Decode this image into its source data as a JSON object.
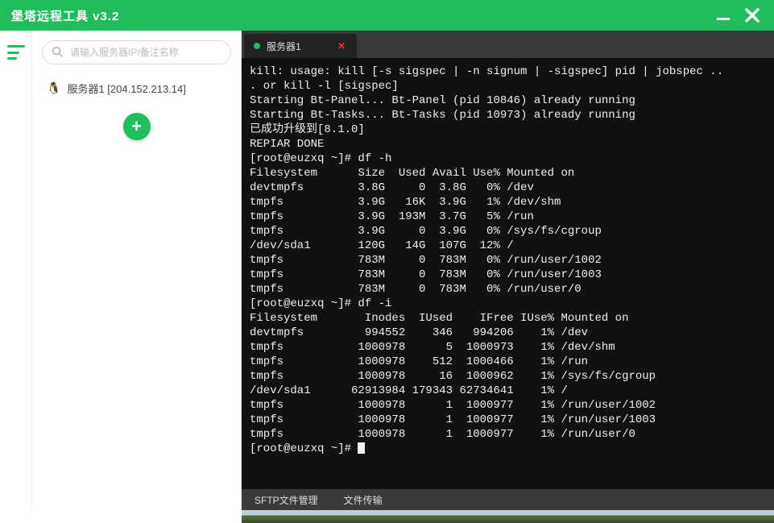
{
  "colors": {
    "accent": "#1fbe5b"
  },
  "titlebar": {
    "title": "堡塔远程工具 v3.2"
  },
  "sidebar": {
    "search_placeholder": "请输入服务器IP/备注名称",
    "servers": [
      {
        "icon": "penguin",
        "label": "服务器1 [204.152.213.14]"
      }
    ],
    "add_label": "+"
  },
  "tabs": [
    {
      "label": "服务器1",
      "active": true,
      "status": "connected"
    }
  ],
  "terminal": {
    "prompt": "[root@euzxq ~]#",
    "lines": [
      "kill: usage: kill [-s sigspec | -n signum | -sigspec] pid | jobspec ..",
      ". or kill -l [sigspec]",
      "Starting Bt-Panel... Bt-Panel (pid 10846) already running",
      "Starting Bt-Tasks... Bt-Tasks (pid 10973) already running",
      "已成功升级到[8.1.0]",
      "REPIAR DONE",
      "[root@euzxq ~]# df -h",
      "Filesystem      Size  Used Avail Use% Mounted on",
      "devtmpfs        3.8G     0  3.8G   0% /dev",
      "tmpfs           3.9G   16K  3.9G   1% /dev/shm",
      "tmpfs           3.9G  193M  3.7G   5% /run",
      "tmpfs           3.9G     0  3.9G   0% /sys/fs/cgroup",
      "/dev/sda1       120G   14G  107G  12% /",
      "tmpfs           783M     0  783M   0% /run/user/1002",
      "tmpfs           783M     0  783M   0% /run/user/1003",
      "tmpfs           783M     0  783M   0% /run/user/0",
      "[root@euzxq ~]# df -i",
      "Filesystem       Inodes  IUsed    IFree IUse% Mounted on",
      "devtmpfs         994552    346   994206    1% /dev",
      "tmpfs           1000978      5  1000973    1% /dev/shm",
      "tmpfs           1000978    512  1000466    1% /run",
      "tmpfs           1000978     16  1000962    1% /sys/fs/cgroup",
      "/dev/sda1      62913984 179343 62734641    1% /",
      "tmpfs           1000978      1  1000977    1% /run/user/1002",
      "tmpfs           1000978      1  1000977    1% /run/user/1003",
      "tmpfs           1000978      1  1000977    1% /run/user/0",
      "[root@euzxq ~]# "
    ]
  },
  "footer": {
    "items": [
      "SFTP文件管理",
      "文件传输"
    ]
  }
}
